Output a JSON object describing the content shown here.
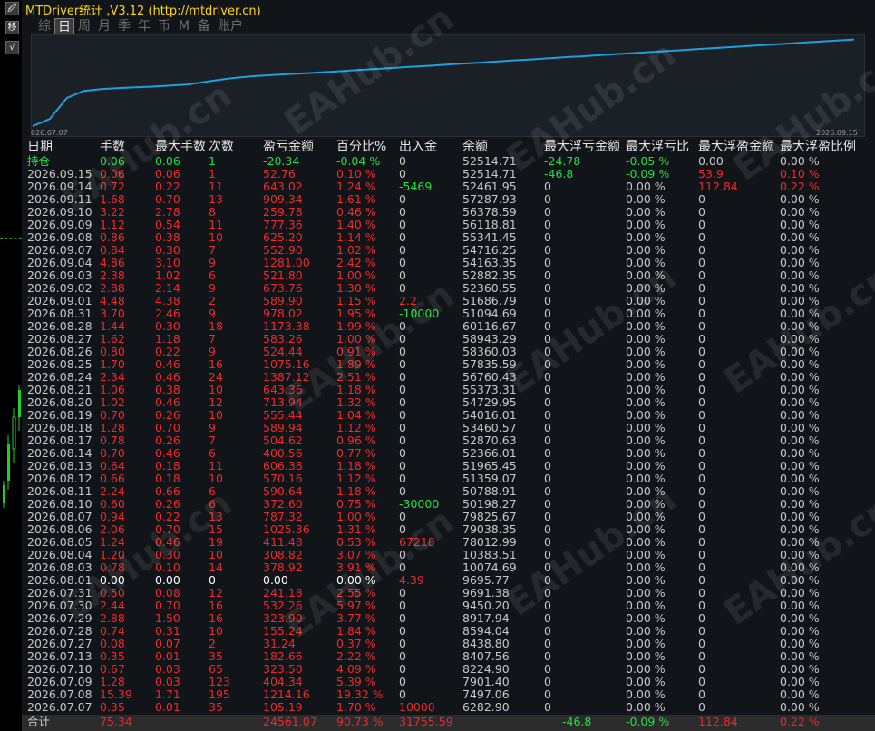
{
  "app": {
    "title": "MTDriver统计 ,V3.12 (http://mtdriver.cn)",
    "side_icons": [
      "🖉",
      "移",
      "√"
    ],
    "watermark": "EAHub.cn"
  },
  "tabs": [
    {
      "label": "综",
      "active": false
    },
    {
      "label": "日",
      "active": true
    },
    {
      "label": "周",
      "active": false
    },
    {
      "label": "月",
      "active": false
    },
    {
      "label": "季",
      "active": false
    },
    {
      "label": "年",
      "active": false
    },
    {
      "label": "币",
      "active": false
    },
    {
      "label": "M",
      "active": false
    },
    {
      "label": "备",
      "active": false
    },
    {
      "label": "账户",
      "active": false
    }
  ],
  "chart_data": {
    "type": "line",
    "x_start_label": "026.07.07",
    "x_end_label": "2026.09.15",
    "series_color": "#1e9fe0",
    "values": [
      0,
      2,
      8,
      10,
      10.5,
      10.8,
      11,
      11.2,
      11.5,
      11.8,
      12.5,
      13.2,
      13.8,
      14.2,
      14.5,
      14.8,
      15,
      15.3,
      15.6,
      15.9,
      16.2,
      16.5,
      16.8,
      17.1,
      17.4,
      17.7,
      18,
      18.3,
      18.6,
      18.9,
      19.2,
      19.5,
      19.8,
      20.1,
      20.4,
      20.7,
      21,
      21.3,
      21.6,
      21.9,
      22.2,
      22.5,
      22.8,
      23.1,
      23.4,
      23.7,
      24,
      24.3,
      24.6
    ],
    "ylim": [
      0,
      25
    ]
  },
  "table": {
    "headers": [
      "日期",
      "手数",
      "最大手数",
      "次数",
      "盈亏金额",
      "百分比%",
      "出入金",
      "余额",
      "最大浮亏金额",
      "最大浮亏比",
      "最大浮盈金额",
      "最大浮盈比例"
    ],
    "holding": {
      "label": "持仓",
      "lots": "0.06",
      "max_lots": "0.06",
      "count": "1",
      "pnl": "-20.34",
      "pct": "-0.04 %",
      "flow": "0",
      "balance": "52514.71",
      "max_loss": "-24.78",
      "max_loss_pct": "-0.05 %",
      "max_gain": "0.00",
      "max_gain_pct": "0.00 %"
    },
    "rows": [
      [
        "2026.09.15",
        "0.06",
        "0.06",
        "1",
        "52.76",
        "0.10 %",
        "0",
        "52514.71",
        "-46.8",
        "-0.09 %",
        "53.9",
        "0.10 %"
      ],
      [
        "2026.09.14",
        "0.72",
        "0.22",
        "11",
        "643.02",
        "1.24 %",
        "-5469",
        "52461.95",
        "0",
        "0.00 %",
        "112.84",
        "0.22 %"
      ],
      [
        "2026.09.11",
        "1.68",
        "0.70",
        "13",
        "909.34",
        "1.61 %",
        "0",
        "57287.93",
        "0",
        "0.00 %",
        "0",
        "0.00 %"
      ],
      [
        "2026.09.10",
        "3.22",
        "2.78",
        "8",
        "259.78",
        "0.46 %",
        "0",
        "56378.59",
        "0",
        "0.00 %",
        "0",
        "0.00 %"
      ],
      [
        "2026.09.09",
        "1.12",
        "0.54",
        "11",
        "777.36",
        "1.40 %",
        "0",
        "56118.81",
        "0",
        "0.00 %",
        "0",
        "0.00 %"
      ],
      [
        "2026.09.08",
        "0.86",
        "0.38",
        "10",
        "625.20",
        "1.14 %",
        "0",
        "55341.45",
        "0",
        "0.00 %",
        "0",
        "0.00 %"
      ],
      [
        "2026.09.07",
        "0.84",
        "0.30",
        "7",
        "552.90",
        "1.02 %",
        "0",
        "54716.25",
        "0",
        "0.00 %",
        "0",
        "0.00 %"
      ],
      [
        "2026.09.04",
        "4.86",
        "3.10",
        "9",
        "1281.00",
        "2.42 %",
        "0",
        "54163.35",
        "0",
        "0.00 %",
        "0",
        "0.00 %"
      ],
      [
        "2026.09.03",
        "2.38",
        "1.02",
        "6",
        "521.80",
        "1.00 %",
        "0",
        "52882.35",
        "0",
        "0.00 %",
        "0",
        "0.00 %"
      ],
      [
        "2026.09.02",
        "2.88",
        "2.14",
        "9",
        "673.76",
        "1.30 %",
        "0",
        "52360.55",
        "0",
        "0.00 %",
        "0",
        "0.00 %"
      ],
      [
        "2026.09.01",
        "4.48",
        "4.38",
        "2",
        "589.90",
        "1.15 %",
        "2.2",
        "51686.79",
        "0",
        "0.00 %",
        "0",
        "0.00 %"
      ],
      [
        "2026.08.31",
        "3.70",
        "2.46",
        "9",
        "978.02",
        "1.95 %",
        "-10000",
        "51094.69",
        "0",
        "0.00 %",
        "0",
        "0.00 %"
      ],
      [
        "2026.08.28",
        "1.44",
        "0.30",
        "18",
        "1173.38",
        "1.99 %",
        "0",
        "60116.67",
        "0",
        "0.00 %",
        "0",
        "0.00 %"
      ],
      [
        "2026.08.27",
        "1.62",
        "1.18",
        "7",
        "583.26",
        "1.00 %",
        "0",
        "58943.29",
        "0",
        "0.00 %",
        "0",
        "0.00 %"
      ],
      [
        "2026.08.26",
        "0.80",
        "0.22",
        "9",
        "524.44",
        "0.91 %",
        "0",
        "58360.03",
        "0",
        "0.00 %",
        "0",
        "0.00 %"
      ],
      [
        "2026.08.25",
        "1.70",
        "0.46",
        "16",
        "1075.16",
        "1.89 %",
        "0",
        "57835.59",
        "0",
        "0.00 %",
        "0",
        "0.00 %"
      ],
      [
        "2026.08.24",
        "2.34",
        "0.46",
        "24",
        "1387.12",
        "2.51 %",
        "0",
        "56760.43",
        "0",
        "0.00 %",
        "0",
        "0.00 %"
      ],
      [
        "2026.08.21",
        "1.06",
        "0.38",
        "10",
        "643.36",
        "1.18 %",
        "0",
        "55373.31",
        "0",
        "0.00 %",
        "0",
        "0.00 %"
      ],
      [
        "2026.08.20",
        "1.02",
        "0.46",
        "12",
        "713.94",
        "1.32 %",
        "0",
        "54729.95",
        "0",
        "0.00 %",
        "0",
        "0.00 %"
      ],
      [
        "2026.08.19",
        "0.70",
        "0.26",
        "10",
        "555.44",
        "1.04 %",
        "0",
        "54016.01",
        "0",
        "0.00 %",
        "0",
        "0.00 %"
      ],
      [
        "2026.08.18",
        "1.28",
        "0.70",
        "9",
        "589.94",
        "1.12 %",
        "0",
        "53460.57",
        "0",
        "0.00 %",
        "0",
        "0.00 %"
      ],
      [
        "2026.08.17",
        "0.78",
        "0.26",
        "7",
        "504.62",
        "0.96 %",
        "0",
        "52870.63",
        "0",
        "0.00 %",
        "0",
        "0.00 %"
      ],
      [
        "2026.08.14",
        "0.70",
        "0.46",
        "6",
        "400.56",
        "0.77 %",
        "0",
        "52366.01",
        "0",
        "0.00 %",
        "0",
        "0.00 %"
      ],
      [
        "2026.08.13",
        "0.64",
        "0.18",
        "11",
        "606.38",
        "1.18 %",
        "0",
        "51965.45",
        "0",
        "0.00 %",
        "0",
        "0.00 %"
      ],
      [
        "2026.08.12",
        "0.66",
        "0.18",
        "10",
        "570.16",
        "1.12 %",
        "0",
        "51359.07",
        "0",
        "0.00 %",
        "0",
        "0.00 %"
      ],
      [
        "2026.08.11",
        "2.24",
        "0.66",
        "6",
        "590.64",
        "1.18 %",
        "0",
        "50788.91",
        "0",
        "0.00 %",
        "0",
        "0.00 %"
      ],
      [
        "2026.08.10",
        "0.60",
        "0.26",
        "6",
        "372.60",
        "0.75 %",
        "-30000",
        "50198.27",
        "0",
        "0.00 %",
        "0",
        "0.00 %"
      ],
      [
        "2026.08.07",
        "0.94",
        "0.22",
        "13",
        "787.32",
        "1.00 %",
        "0",
        "79825.67",
        "0",
        "0.00 %",
        "0",
        "0.00 %"
      ],
      [
        "2026.08.06",
        "2.06",
        "0.70",
        "15",
        "1025.36",
        "1.31 %",
        "0",
        "79038.35",
        "0",
        "0.00 %",
        "0",
        "0.00 %"
      ],
      [
        "2026.08.05",
        "1.24",
        "0.46",
        "19",
        "411.48",
        "0.53 %",
        "67218",
        "78012.99",
        "0",
        "0.00 %",
        "0",
        "0.00 %"
      ],
      [
        "2026.08.04",
        "1.20",
        "0.30",
        "10",
        "308.82",
        "3.07 %",
        "0",
        "10383.51",
        "0",
        "0.00 %",
        "0",
        "0.00 %"
      ],
      [
        "2026.08.03",
        "0.78",
        "0.10",
        "14",
        "378.92",
        "3.91 %",
        "0",
        "10074.69",
        "0",
        "0.00 %",
        "0",
        "0.00 %"
      ],
      [
        "2026.08.01",
        "0.00",
        "0.00",
        "0",
        "0.00",
        "0.00 %",
        "4.39",
        "9695.77",
        "0",
        "0.00 %",
        "0",
        "0.00 %"
      ],
      [
        "2026.07.31",
        "0.50",
        "0.08",
        "12",
        "241.18",
        "2.55 %",
        "0",
        "9691.38",
        "0",
        "0.00 %",
        "0",
        "0.00 %"
      ],
      [
        "2026.07.30",
        "2.44",
        "0.70",
        "16",
        "532.26",
        "5.97 %",
        "0",
        "9450.20",
        "0",
        "0.00 %",
        "0",
        "0.00 %"
      ],
      [
        "2026.07.29",
        "2.88",
        "1.50",
        "16",
        "323.90",
        "3.77 %",
        "0",
        "8917.94",
        "0",
        "0.00 %",
        "0",
        "0.00 %"
      ],
      [
        "2026.07.28",
        "0.74",
        "0.31",
        "10",
        "155.24",
        "1.84 %",
        "0",
        "8594.04",
        "0",
        "0.00 %",
        "0",
        "0.00 %"
      ],
      [
        "2026.07.27",
        "0.08",
        "0.07",
        "2",
        "31.24",
        "0.37 %",
        "0",
        "8438.80",
        "0",
        "0.00 %",
        "0",
        "0.00 %"
      ],
      [
        "2026.07.13",
        "0.35",
        "0.01",
        "35",
        "182.66",
        "2.22 %",
        "0",
        "8407.56",
        "0",
        "0.00 %",
        "0",
        "0.00 %"
      ],
      [
        "2026.07.10",
        "0.67",
        "0.03",
        "65",
        "323.50",
        "4.09 %",
        "0",
        "8224.90",
        "0",
        "0.00 %",
        "0",
        "0.00 %"
      ],
      [
        "2026.07.09",
        "1.28",
        "0.03",
        "123",
        "404.34",
        "5.39 %",
        "0",
        "7901.40",
        "0",
        "0.00 %",
        "0",
        "0.00 %"
      ],
      [
        "2026.07.08",
        "15.39",
        "1.71",
        "195",
        "1214.16",
        "19.32 %",
        "0",
        "7497.06",
        "0",
        "0.00 %",
        "0",
        "0.00 %"
      ],
      [
        "2026.07.07",
        "0.35",
        "0.01",
        "35",
        "105.19",
        "1.70 %",
        "10000",
        "6282.90",
        "0",
        "0.00 %",
        "0",
        "0.00 %"
      ]
    ],
    "total": {
      "label": "合计",
      "lots": "75.34",
      "pnl": "24561.07",
      "pct": "90.73 %",
      "flow": "31755.59",
      "max_loss": "-46.8",
      "max_loss_pct": "-0.09 %",
      "max_gain": "112.84",
      "max_gain_pct": "0.22 %"
    }
  }
}
